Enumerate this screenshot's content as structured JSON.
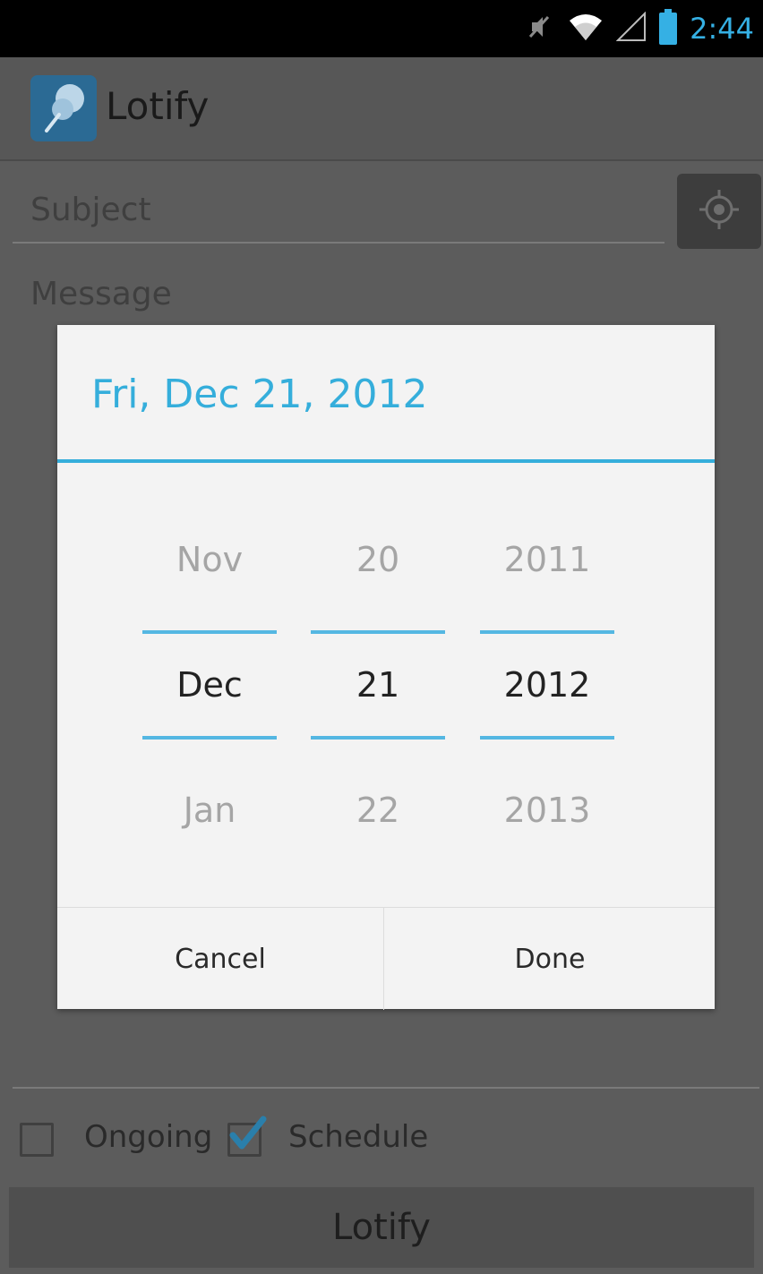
{
  "status_bar": {
    "time": "2:44",
    "icons": [
      "mute-icon",
      "wifi-icon",
      "signal-icon",
      "battery-icon"
    ]
  },
  "action_bar": {
    "title": "Lotify",
    "icon": "pushpin-icon"
  },
  "form": {
    "subject_placeholder": "Subject",
    "message_placeholder": "Message",
    "locate_icon": "crosshair-icon",
    "ongoing_label": "Ongoing",
    "ongoing_checked": false,
    "schedule_label": "Schedule",
    "schedule_checked": true,
    "submit_label": "Lotify"
  },
  "date_dialog": {
    "title": "Fri, Dec 21, 2012",
    "month": {
      "prev": "Nov",
      "current": "Dec",
      "next": "Jan"
    },
    "day": {
      "prev": "20",
      "current": "21",
      "next": "22"
    },
    "year": {
      "prev": "2011",
      "current": "2012",
      "next": "2013"
    },
    "cancel_label": "Cancel",
    "done_label": "Done"
  },
  "colors": {
    "accent": "#35aedb",
    "status_clock": "#35b0e4",
    "dim_overlay_bg": "#5c5c5c"
  }
}
